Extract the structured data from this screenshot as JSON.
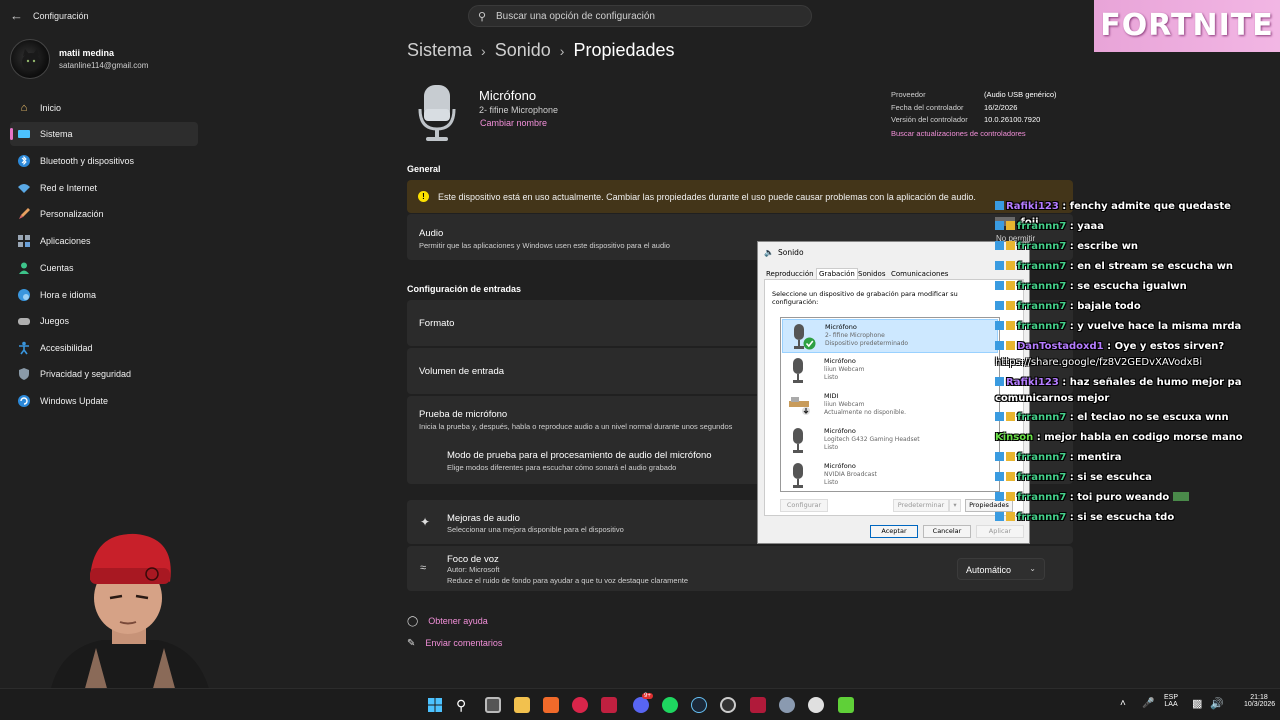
{
  "window": {
    "title": "Configuración"
  },
  "search": {
    "placeholder": "Buscar una opción de configuración"
  },
  "overlay": {
    "fortnite_label": "FORTNITE"
  },
  "profile": {
    "name": "matii medina",
    "email": "satanline114@gmail.com"
  },
  "sidebar": {
    "items": [
      {
        "label": "Inicio",
        "icon": "home-icon"
      },
      {
        "label": "Sistema",
        "icon": "system-icon",
        "selected": true
      },
      {
        "label": "Bluetooth y dispositivos",
        "icon": "bluetooth-icon"
      },
      {
        "label": "Red e Internet",
        "icon": "wifi-icon"
      },
      {
        "label": "Personalización",
        "icon": "brush-icon"
      },
      {
        "label": "Aplicaciones",
        "icon": "apps-icon"
      },
      {
        "label": "Cuentas",
        "icon": "person-icon"
      },
      {
        "label": "Hora e idioma",
        "icon": "globe-icon"
      },
      {
        "label": "Juegos",
        "icon": "controller-icon"
      },
      {
        "label": "Accesibilidad",
        "icon": "accessibility-icon"
      },
      {
        "label": "Privacidad y seguridad",
        "icon": "shield-icon"
      },
      {
        "label": "Windows Update",
        "icon": "update-icon"
      }
    ]
  },
  "breadcrumb": {
    "part1": "Sistema",
    "part2": "Sonido",
    "part3": "Propiedades"
  },
  "device": {
    "title": "Micrófono",
    "subtitle": "2- fifine Microphone",
    "rename_link": "Cambiar nombre",
    "props_labels": [
      "Proveedor",
      "Fecha del controlador",
      "Versión del controlador"
    ],
    "props_values": [
      "(Audio USB genérico)",
      "16/2/2026",
      "10.0.26100.7920"
    ],
    "driver_link": "Buscar actualizaciones de controladores"
  },
  "general": {
    "heading": "General",
    "warning": "Este dispositivo está en uso actualmente. Cambiar las propiedades durante el uso puede causar problemas con la aplicación de audio.",
    "audio_title": "Audio",
    "audio_desc": "Permitir que las aplicaciones y Windows usen este dispositivo para el audio",
    "audio_toggle": "No permitir"
  },
  "input": {
    "heading": "Configuración de entradas",
    "format": "Formato",
    "volume": "Volumen de entrada",
    "test_title": "Prueba de micrófono",
    "test_desc": "Inicia la prueba y, después, habla o reproduce audio a un nivel normal durante unos segundos",
    "mode_title": "Modo de prueba para el procesamiento de audio del micrófono",
    "mode_desc": "Elige modos diferentes para escuchar cómo sonará el audio grabado",
    "enh_title": "Mejoras de audio",
    "enh_desc": "Seleccionar una mejora disponible para el dispositivo",
    "voice_title": "Foco de voz",
    "voice_author": "Autor: Microsoft",
    "voice_desc": "Reduce el ruido de fondo para ayudar a que tu voz destaque claramente",
    "voice_value": "Automático"
  },
  "help": {
    "get_help": "Obtener ayuda",
    "feedback": "Enviar comentarios"
  },
  "dialog": {
    "title": "Sonido",
    "tabs": [
      "Reproducción",
      "Grabación",
      "Sonidos",
      "Comunicaciones"
    ],
    "instruction": "Seleccione un dispositivo de grabación para modificar su configuración:",
    "devices": [
      {
        "name": "Micrófono",
        "desc": "2- fifine Microphone",
        "status": "Dispositivo predeterminado"
      },
      {
        "name": "Micrófono",
        "desc": "liiun Webcam",
        "status": "Listo"
      },
      {
        "name": "MIDI",
        "desc": "liiun Webcam",
        "status": "Actualmente no disponible."
      },
      {
        "name": "Micrófono",
        "desc": "Logitech G432 Gaming Headset",
        "status": "Listo"
      },
      {
        "name": "Micrófono",
        "desc": "NVIDIA Broadcast",
        "status": "Listo"
      }
    ],
    "btn_configure": "Configurar",
    "btn_default": "Predeterminar",
    "btn_properties": "Propiedades",
    "btn_ok": "Aceptar",
    "btn_cancel": "Cancelar",
    "btn_apply": "Aplicar"
  },
  "chat": {
    "messages": [
      {
        "user": "Rafiki123",
        "text": ": fenchy admite que quedaste",
        "tail": "foji",
        "color": "#b57cff"
      },
      {
        "user": "frrannn7",
        "text": ": yaaa",
        "color": "#44d08a"
      },
      {
        "user": "frrannn7",
        "text": ": escribe wn",
        "color": "#44d08a"
      },
      {
        "user": "frrannn7",
        "text": ": en el stream se escucha wn",
        "color": "#44d08a"
      },
      {
        "user": "frrannn7",
        "text": ": se escucha igualwn",
        "color": "#44d08a"
      },
      {
        "user": "frrannn7",
        "text": ": bajale todo",
        "color": "#44d08a"
      },
      {
        "user": "frrannn7",
        "text": ": y vuelve hace la misma mrda",
        "color": "#44d08a"
      },
      {
        "user": "DanTostadoxd1",
        "text": ": Oye y estos sirven?",
        "line2": "https://share.google/fz8V2GEDvXAVodxBi",
        "color": "#b57cff"
      },
      {
        "user": "Rafiki123",
        "text": ": haz señales de humo mejor pa",
        "line2": "comunicarnos mejor",
        "color": "#b57cff"
      },
      {
        "user": "frrannn7",
        "text": ": el teclao no se escuxa wnn",
        "color": "#44d08a"
      },
      {
        "user": "Kinson",
        "text": ": mejor habla en codigo morse mano",
        "color": "#6be24a"
      },
      {
        "user": "frrannn7",
        "text": ": mentira",
        "color": "#44d08a"
      },
      {
        "user": "frrannn7",
        "text": ": si se escuhca",
        "color": "#44d08a"
      },
      {
        "user": "frrannn7",
        "text": ": toi puro weando",
        "color": "#44d08a"
      },
      {
        "user": "frrannn7",
        "text": ": si se escucha tdo",
        "color": "#44d08a"
      }
    ]
  },
  "taskbar": {
    "lang_top": "ESP",
    "lang_bottom": "LAA",
    "time": "21:18",
    "date": "10/3/2026",
    "discord_badge": "9+"
  }
}
